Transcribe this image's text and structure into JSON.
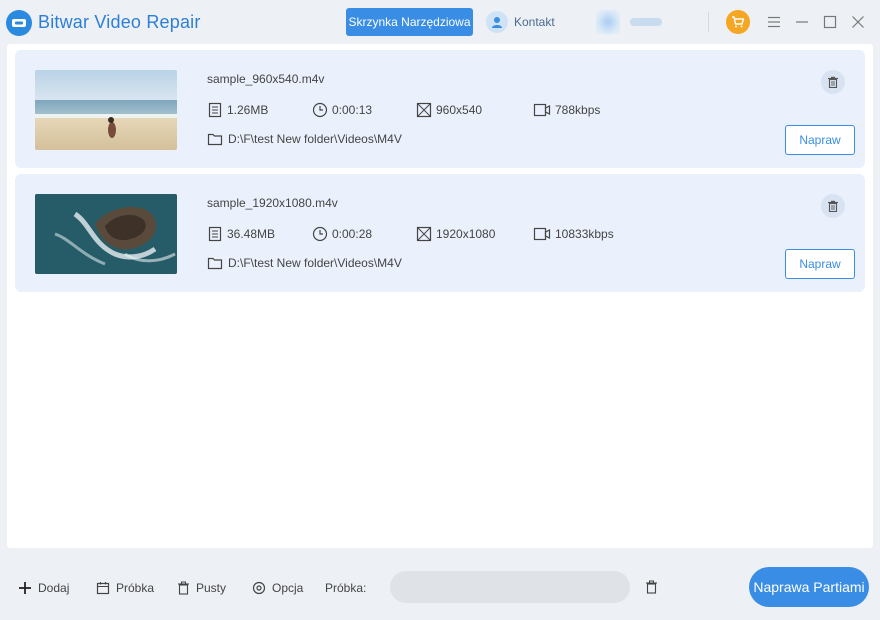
{
  "app": {
    "title": "Bitwar Video Repair",
    "accent_color": "#3a8de4"
  },
  "header": {
    "toolbox_label": "Skrzynka Narzędziowa",
    "contact_label": "Kontakt",
    "user_icon": "user-avatar-blurred",
    "cart_icon": "shopping-cart-icon",
    "window_controls": [
      "menu-icon",
      "minimize-icon",
      "maximize-icon",
      "close-icon"
    ]
  },
  "files": [
    {
      "name": "sample_960x540.m4v",
      "size": "1.26MB",
      "duration": "0:00:13",
      "resolution": "960x540",
      "bitrate": "788kbps",
      "path": "D:\\F\\test New folder\\Videos\\M4V",
      "repair_label": "Napraw",
      "thumbnail": "beach-scene"
    },
    {
      "name": "sample_1920x1080.m4v",
      "size": "36.48MB",
      "duration": "0:00:28",
      "resolution": "1920x1080",
      "bitrate": "10833kbps",
      "path": "D:\\F\\test New folder\\Videos\\M4V",
      "repair_label": "Napraw",
      "thumbnail": "ocean-rock-aerial"
    }
  ],
  "bottom_bar": {
    "add_label": "Dodaj",
    "sample_label": "Próbka",
    "clear_label": "Pusty",
    "option_label": "Opcja",
    "sample_field_label": "Próbka:",
    "sample_field_value": "",
    "batch_repair_label": "Naprawa Partiami"
  }
}
